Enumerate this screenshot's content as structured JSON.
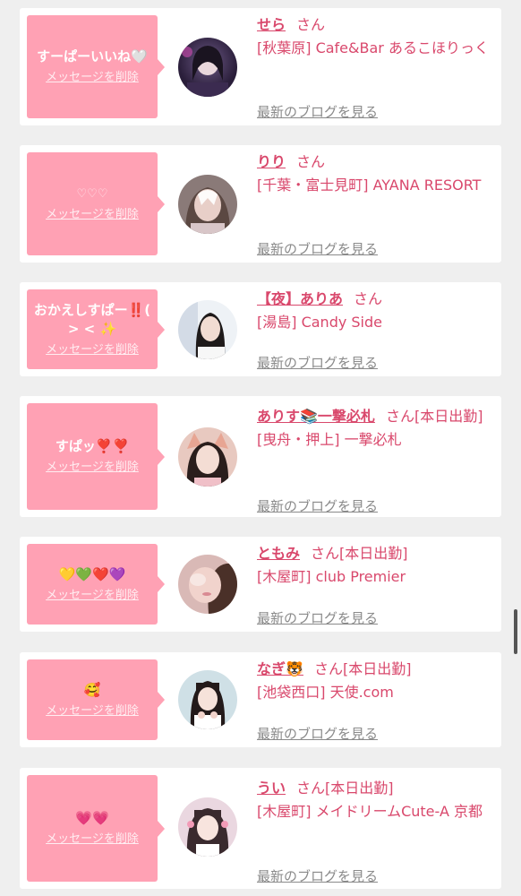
{
  "colors": {
    "background": "#efefef",
    "bubble": "#ffa1b4",
    "accent": "#d9486c",
    "link_gray": "#8a8a8a"
  },
  "entries": [
    {
      "message": "すーぱーいいね🤍",
      "delete_label": "メッセージを削除",
      "name": "せら",
      "honorific": "さん",
      "tag": "",
      "shop": "[秋葉原] Cafe&Bar あるこほりっく",
      "blog_label": "最新のブログを見る"
    },
    {
      "message": "♡♡♡",
      "delete_label": "メッセージを削除",
      "name": "りり",
      "honorific": "さん",
      "tag": "",
      "shop": "[千葉・富士見町] AYANA RESORT",
      "blog_label": "最新のブログを見る"
    },
    {
      "message": "おかえしすぱー‼️( > < ✨",
      "delete_label": "メッセージを削除",
      "name": "【夜】ありあ",
      "honorific": "さん",
      "tag": "",
      "shop": "[湯島] Candy Side",
      "blog_label": "最新のブログを見る"
    },
    {
      "message": "すぱッ❣️❣️",
      "delete_label": "メッセージを削除",
      "name": "ありす📚一撃必札",
      "honorific": "さん",
      "tag": "[本日出勤]",
      "shop": "[曳舟・押上] 一撃必札",
      "blog_label": "最新のブログを見る"
    },
    {
      "message": "💛💚❤️💜",
      "delete_label": "メッセージを削除",
      "name": "ともみ",
      "honorific": "さん",
      "tag": "[本日出勤]",
      "shop": "[木屋町] club Premier",
      "blog_label": "最新のブログを見る"
    },
    {
      "message": "🥰",
      "delete_label": "メッセージを削除",
      "name": "なぎ🐯",
      "honorific": "さん",
      "tag": "[本日出勤]",
      "shop": "[池袋西口] 天使.com",
      "blog_label": "最新のブログを見る"
    },
    {
      "message": "💗💗",
      "delete_label": "メッセージを削除",
      "name": "うい",
      "honorific": "さん",
      "tag": "[本日出勤]",
      "shop": "[木屋町] メイドリームCute-A 京都",
      "blog_label": "最新のブログを見る"
    }
  ]
}
